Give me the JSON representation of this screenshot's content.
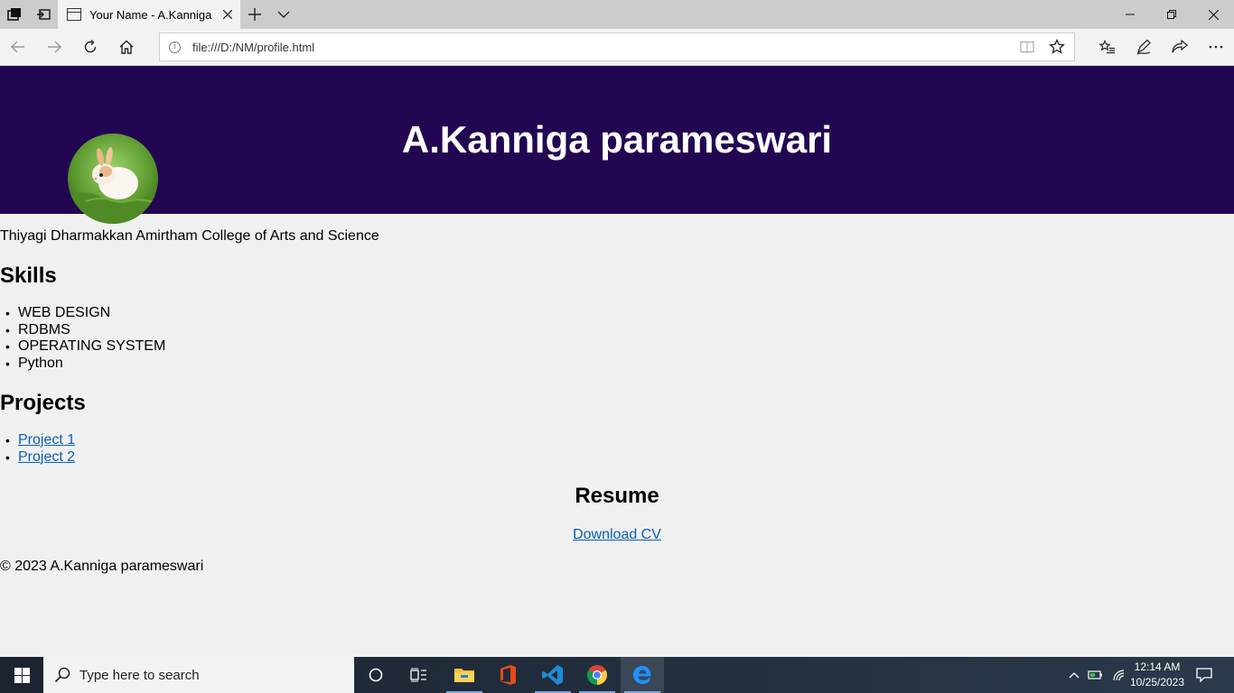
{
  "browser": {
    "tab_title": "Your Name - A.Kanniga",
    "url": "file:///D:/NM/profile.html"
  },
  "page": {
    "name": "A.Kanniga parameswari",
    "college": "Thiyagi Dharmakkan Amirtham College of Arts and Science",
    "skills_heading": "Skills",
    "skills": [
      "WEB DESIGN",
      "RDBMS",
      "OPERATING SYSTEM",
      "Python"
    ],
    "projects_heading": "Projects",
    "projects": [
      "Project 1",
      "Project 2"
    ],
    "resume_heading": "Resume",
    "download_label": "Download CV",
    "footer": "© 2023 A.Kanniga parameswari"
  },
  "taskbar": {
    "search_placeholder": "Type here to search",
    "time": "12:14 AM",
    "date": "10/25/2023",
    "apps": [
      "cortana-icon",
      "task-view-icon",
      "file-explorer-icon",
      "office-icon",
      "vscode-icon",
      "chrome-icon",
      "edge-icon"
    ]
  },
  "colors": {
    "header_bg": "#220652",
    "link": "#0b5fb5",
    "page_bg": "#f0f0f0"
  }
}
